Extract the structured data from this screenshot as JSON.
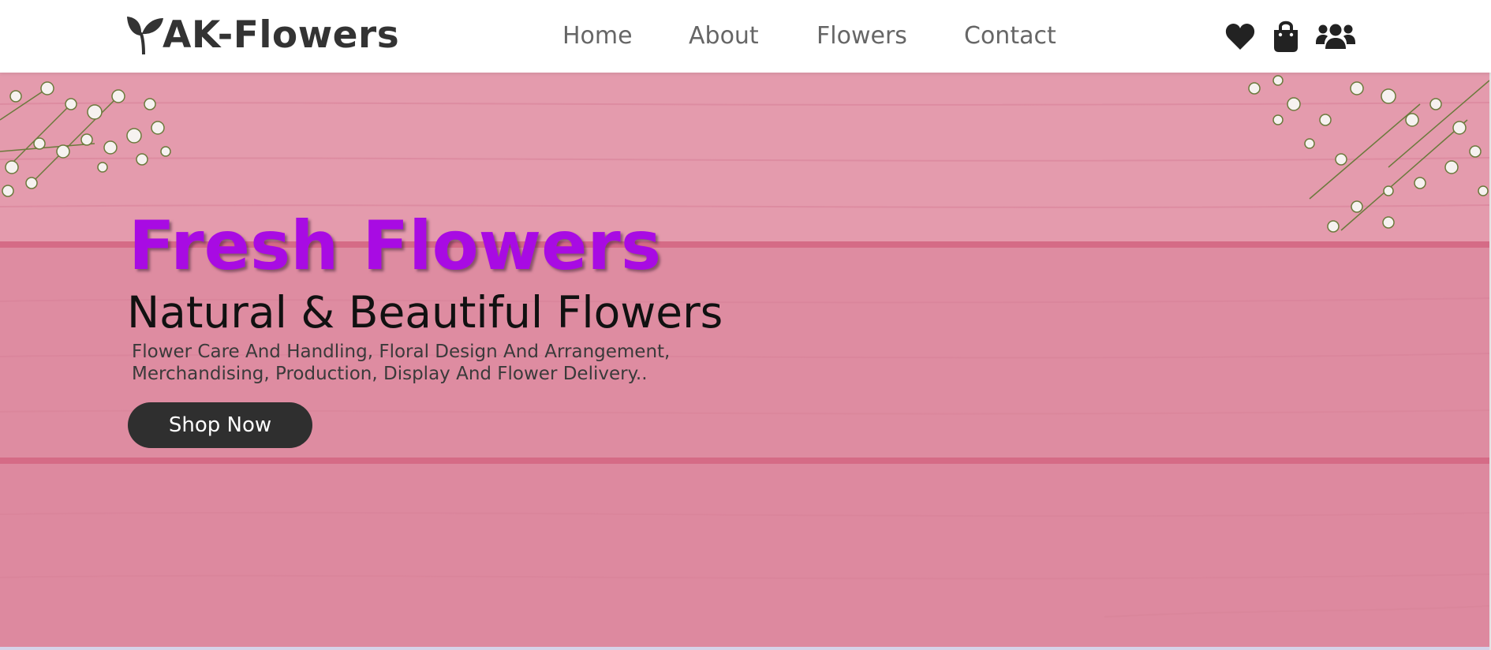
{
  "brand": {
    "name": "AK-Flowers",
    "logo_icon": "sprout-icon"
  },
  "nav": {
    "items": [
      "Home",
      "About",
      "Flowers",
      "Contact"
    ]
  },
  "header_icons": [
    "heart-icon",
    "shopping-bag-icon",
    "users-icon"
  ],
  "hero": {
    "title": "Fresh Flowers",
    "subtitle": "Natural & Beautiful Flowers",
    "description_line1": "Flower Care And Handling, Floral Design And Arrangement,",
    "description_line2": "Merchandising, Production, Display And Flower Delivery..",
    "button": "Shop Now"
  },
  "colors": {
    "title": "#a80be3",
    "hero_background": "#df8ea2",
    "button_background": "#2f2f2f",
    "logo_text": "#333333",
    "nav_text": "#666666"
  }
}
